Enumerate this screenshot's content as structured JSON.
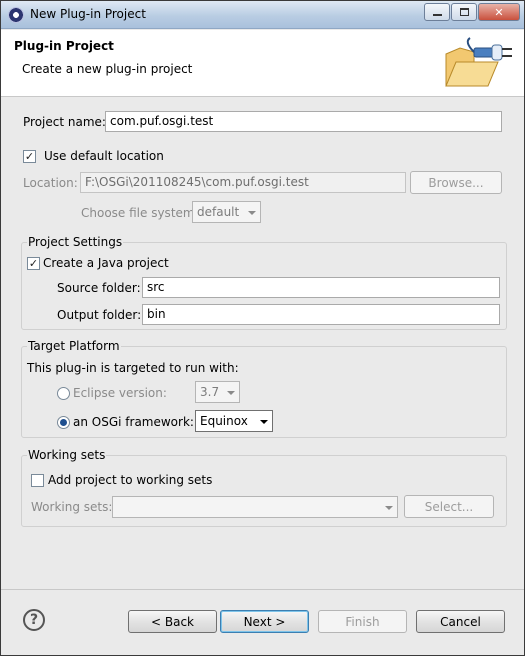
{
  "window": {
    "title": "New Plug-in Project"
  },
  "header": {
    "title": "Plug-in Project",
    "description": "Create a new plug-in project"
  },
  "project": {
    "name_label": "Project name:",
    "name_value": "com.puf.osgi.test",
    "use_default_location_label": "Use default location",
    "use_default_location_checked": true,
    "location_label": "Location:",
    "location_value": "F:\\OSGi\\201108245\\com.puf.osgi.test",
    "browse_button": "Browse...",
    "file_system_label": "Choose file system:",
    "file_system_value": "default"
  },
  "project_settings": {
    "group_title": "Project Settings",
    "create_java_label": "Create a Java project",
    "create_java_checked": true,
    "source_folder_label": "Source folder:",
    "source_folder_value": "src",
    "output_folder_label": "Output folder:",
    "output_folder_value": "bin"
  },
  "target_platform": {
    "group_title": "Target Platform",
    "intro": "This plug-in is targeted to run with:",
    "eclipse_label": "Eclipse version:",
    "eclipse_value": "3.7",
    "eclipse_selected": false,
    "osgi_label": "an OSGi framework:",
    "osgi_value": "Equinox",
    "osgi_selected": true
  },
  "working_sets": {
    "group_title": "Working sets",
    "add_label": "Add project to working sets",
    "add_checked": false,
    "sets_label": "Working sets:",
    "sets_value": "",
    "select_button": "Select..."
  },
  "footer": {
    "help_glyph": "?",
    "back_button": "< Back",
    "next_button": "Next >",
    "finish_button": "Finish",
    "cancel_button": "Cancel"
  }
}
